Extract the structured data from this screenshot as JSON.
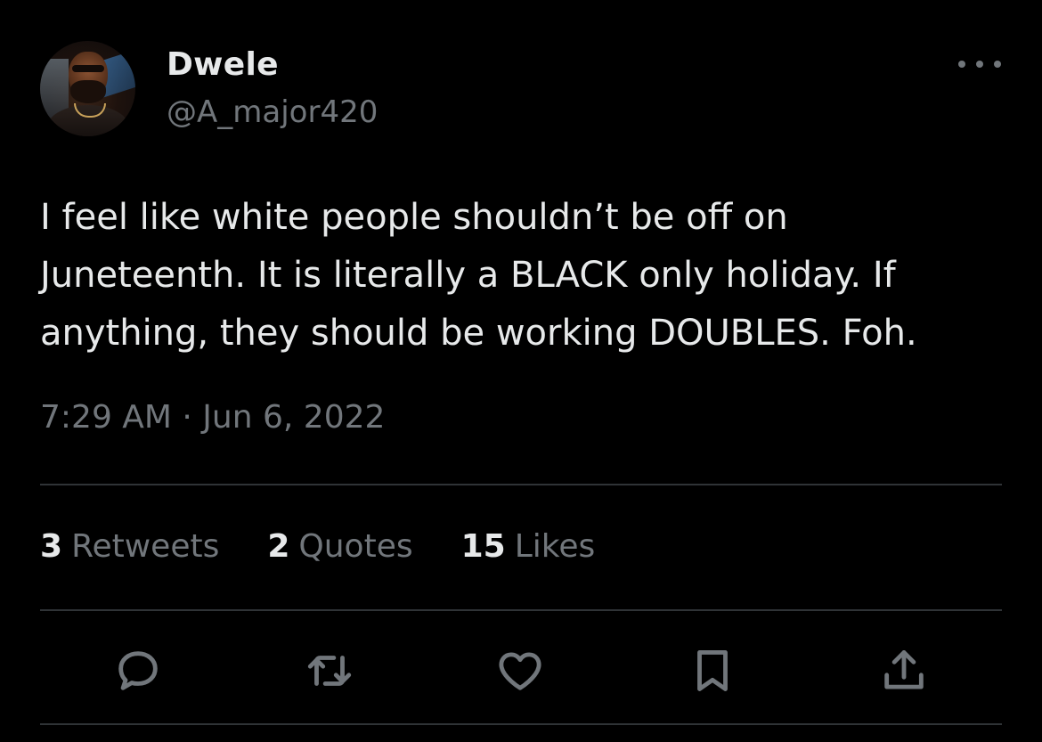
{
  "tweet": {
    "author": {
      "display_name": "Dwele",
      "handle": "@A_major420"
    },
    "text": "I feel like white people shouldn’t be off on Juneteenth. It is literally a BLACK only holiday. If anything, they should be working DOUBLES. Foh.",
    "timestamp": "7:29 AM · Jun 6, 2022"
  },
  "stats": [
    {
      "count": "3",
      "label": "Retweets"
    },
    {
      "count": "2",
      "label": "Quotes"
    },
    {
      "count": "15",
      "label": "Likes"
    }
  ],
  "actions": [
    "reply-icon",
    "retweet-icon",
    "like-icon",
    "bookmark-icon",
    "share-icon"
  ],
  "colors": {
    "background": "#000000",
    "primary_text": "#e7e9ea",
    "secondary_text": "#71767b",
    "divider": "#2f3336"
  }
}
